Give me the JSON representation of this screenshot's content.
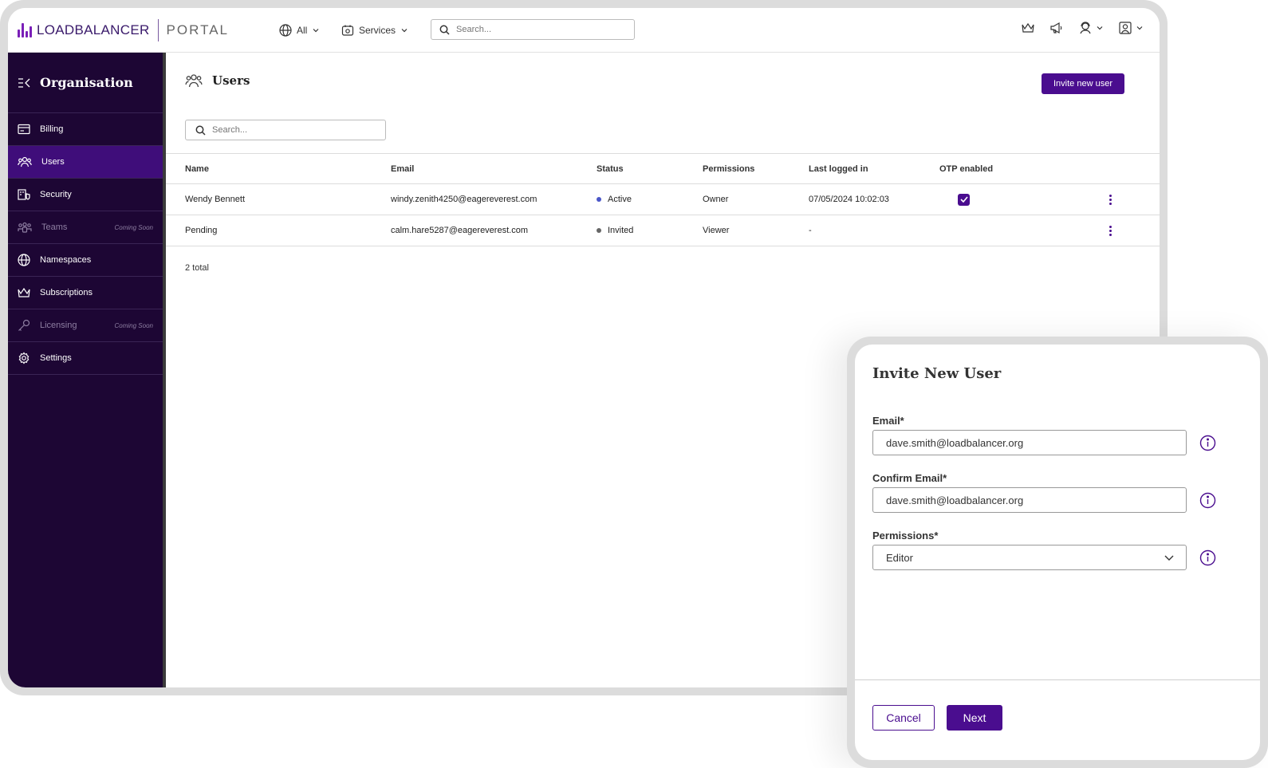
{
  "brand": {
    "logo_text": "LOADBALANCER",
    "portal_text": "PORTAL"
  },
  "topbar": {
    "scope_label": "All",
    "services_label": "Services",
    "search_placeholder": "Search..."
  },
  "sidebar": {
    "title": "Organisation",
    "coming_soon": "Coming Soon",
    "items": [
      {
        "label": "Billing",
        "icon": "billing-icon"
      },
      {
        "label": "Users",
        "icon": "users-icon"
      },
      {
        "label": "Security",
        "icon": "security-icon"
      },
      {
        "label": "Teams",
        "icon": "teams-icon"
      },
      {
        "label": "Namespaces",
        "icon": "globe-icon"
      },
      {
        "label": "Subscriptions",
        "icon": "crown-icon"
      },
      {
        "label": "Licensing",
        "icon": "key-icon"
      },
      {
        "label": "Settings",
        "icon": "gear-icon"
      }
    ]
  },
  "page": {
    "title": "Users",
    "invite_button": "Invite new user",
    "search_placeholder": "Search...",
    "total": "2 total"
  },
  "table": {
    "columns": [
      "Name",
      "Email",
      "Status",
      "Permissions",
      "Last logged in",
      "OTP enabled"
    ],
    "rows": [
      {
        "name": "Wendy Bennett",
        "email": "windy.zenith4250@eagereverest.com",
        "status": "Active",
        "status_color": "#4a56c8",
        "permissions": "Owner",
        "last_login": "07/05/2024 10:02:03",
        "otp": true
      },
      {
        "name": "Pending",
        "email": "calm.hare5287@eagereverest.com",
        "status": "Invited",
        "status_color": "#666666",
        "permissions": "Viewer",
        "last_login": "-",
        "otp": false
      }
    ]
  },
  "modal": {
    "title": "Invite New User",
    "email_label": "Email*",
    "email_value": "dave.smith@loadbalancer.org",
    "confirm_label": "Confirm Email*",
    "confirm_value": "dave.smith@loadbalancer.org",
    "permissions_label": "Permissions*",
    "permissions_value": "Editor",
    "cancel": "Cancel",
    "next": "Next"
  },
  "colors": {
    "brand": "#4a0d8f",
    "sidebar_bg": "#1d0634",
    "sidebar_active": "#3f0d7a"
  }
}
